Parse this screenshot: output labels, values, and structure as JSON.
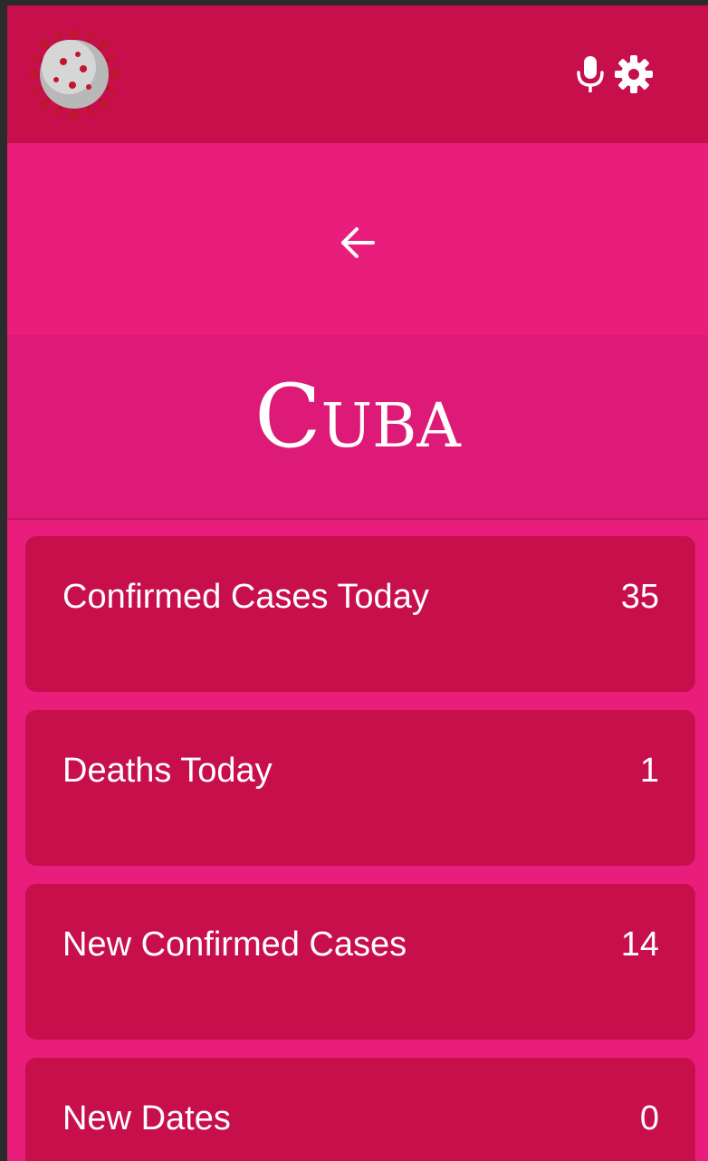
{
  "header": {
    "logo_icon": "coronavirus-logo-icon",
    "mic_icon": "microphone-icon",
    "settings_icon": "gear-icon"
  },
  "nav": {
    "back_icon": "arrow-left-icon"
  },
  "country": {
    "name": "Cuba"
  },
  "stats": [
    {
      "label": "Confirmed Cases Today",
      "value": "35"
    },
    {
      "label": "Deaths Today",
      "value": "1"
    },
    {
      "label": "New Confirmed Cases",
      "value": "14"
    },
    {
      "label": "New Dates",
      "value": "0"
    }
  ],
  "colors": {
    "header_bg": "#c70f4c",
    "page_bg": "#e91e7c",
    "title_bg": "#de1a78",
    "card_bg": "#c70f4c",
    "text": "#ffffff"
  }
}
